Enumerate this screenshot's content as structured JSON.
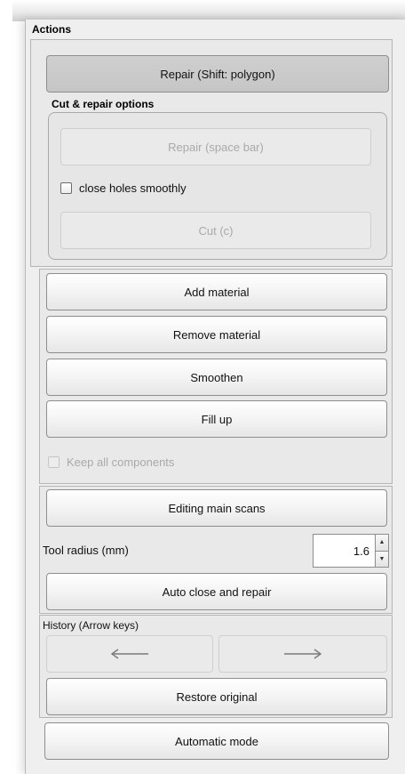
{
  "panel": {
    "title": "Actions"
  },
  "repair_polygon_button": "Repair (Shift: polygon)",
  "cut_repair": {
    "title": "Cut & repair options",
    "repair_button": "Repair (space bar)",
    "close_holes_label": "close holes smoothly",
    "close_holes_checked": false,
    "cut_button": "Cut (c)"
  },
  "material": {
    "add": "Add material",
    "remove": "Remove material",
    "smoothen": "Smoothen",
    "fill": "Fill up",
    "keep_components_label": "Keep all components",
    "keep_components_checked": false
  },
  "scans": {
    "editing_button": "Editing main scans",
    "tool_radius_label": "Tool radius (mm)",
    "tool_radius_value": "1.6",
    "auto_close_button": "Auto close and repair"
  },
  "history": {
    "title": "History (Arrow keys)",
    "back_icon": "arrow-left-icon",
    "forward_icon": "arrow-right-icon",
    "restore_button": "Restore original"
  },
  "automatic_mode_button": "Automatic mode"
}
